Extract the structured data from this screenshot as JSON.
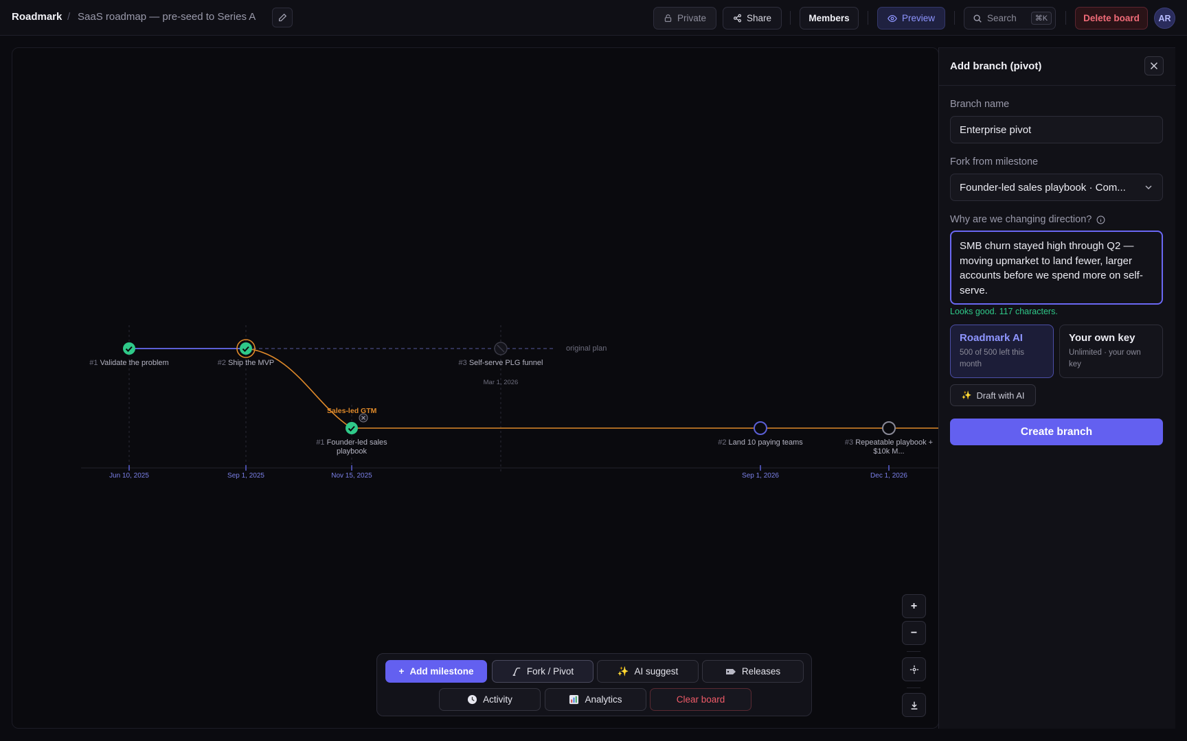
{
  "header": {
    "brand": "Roadmark",
    "separator": "/",
    "board_title": "SaaS roadmap — pre-seed to Series A",
    "private_label": "Private",
    "share_label": "Share",
    "members_label": "Members",
    "preview_label": "Preview",
    "search_label": "Search",
    "search_shortcut": "⌘K",
    "delete_label": "Delete board",
    "avatar_initials": "AR"
  },
  "timeline": {
    "original_plan_label": "original plan",
    "branch_label": "Sales-led GTM",
    "milestones": [
      {
        "num": "#1",
        "title": "Validate the problem",
        "status": "done",
        "lane": "main"
      },
      {
        "num": "#2",
        "title": "Ship the MVP",
        "status": "done",
        "lane": "main"
      },
      {
        "num": "#3",
        "title": "Self-serve PLG funnel",
        "date": "Mar 1, 2026",
        "status": "abandoned",
        "lane": "main"
      },
      {
        "num": "#1",
        "title": "Founder-led sales playbook",
        "status": "done",
        "lane": "branch"
      },
      {
        "num": "#2",
        "title": "Land 10 paying teams",
        "status": "planned",
        "lane": "branch"
      },
      {
        "num": "#3",
        "title": "Repeatable playbook + $10k M...",
        "status": "planned",
        "lane": "branch"
      }
    ],
    "axis_dates": [
      "Jun 10, 2025",
      "Sep 1, 2025",
      "Nov 15, 2025",
      "Sep 1, 2026",
      "Dec 1, 2026"
    ],
    "colors": {
      "main": "#5b5fd6",
      "branch": "#e08a2a",
      "done": "#2fc989",
      "accent": "#6360f0"
    }
  },
  "toolbar": {
    "add_milestone": "Add milestone",
    "fork_pivot": "Fork / Pivot",
    "ai_suggest": "AI suggest",
    "releases": "Releases",
    "activity": "Activity",
    "analytics": "Analytics",
    "clear_board": "Clear board"
  },
  "zoom": {
    "in": "+",
    "out": "−"
  },
  "panel": {
    "title": "Add branch (pivot)",
    "branch_name_label": "Branch name",
    "branch_name_value": "Enterprise pivot",
    "fork_label": "Fork from milestone",
    "fork_value": "Founder-led sales playbook · Com...",
    "why_label": "Why are we changing direction?",
    "why_value": "SMB churn stayed high through Q2 — moving upmarket to land fewer, larger accounts before we spend more on self-serve.",
    "validation": "Looks good. 117 characters.",
    "option_ai_title": "Roadmark AI",
    "option_ai_sub": "500 of 500 left this month",
    "option_key_title": "Your own key",
    "option_key_sub": "Unlimited · your own key",
    "draft_label": "Draft with AI",
    "create_label": "Create branch"
  }
}
